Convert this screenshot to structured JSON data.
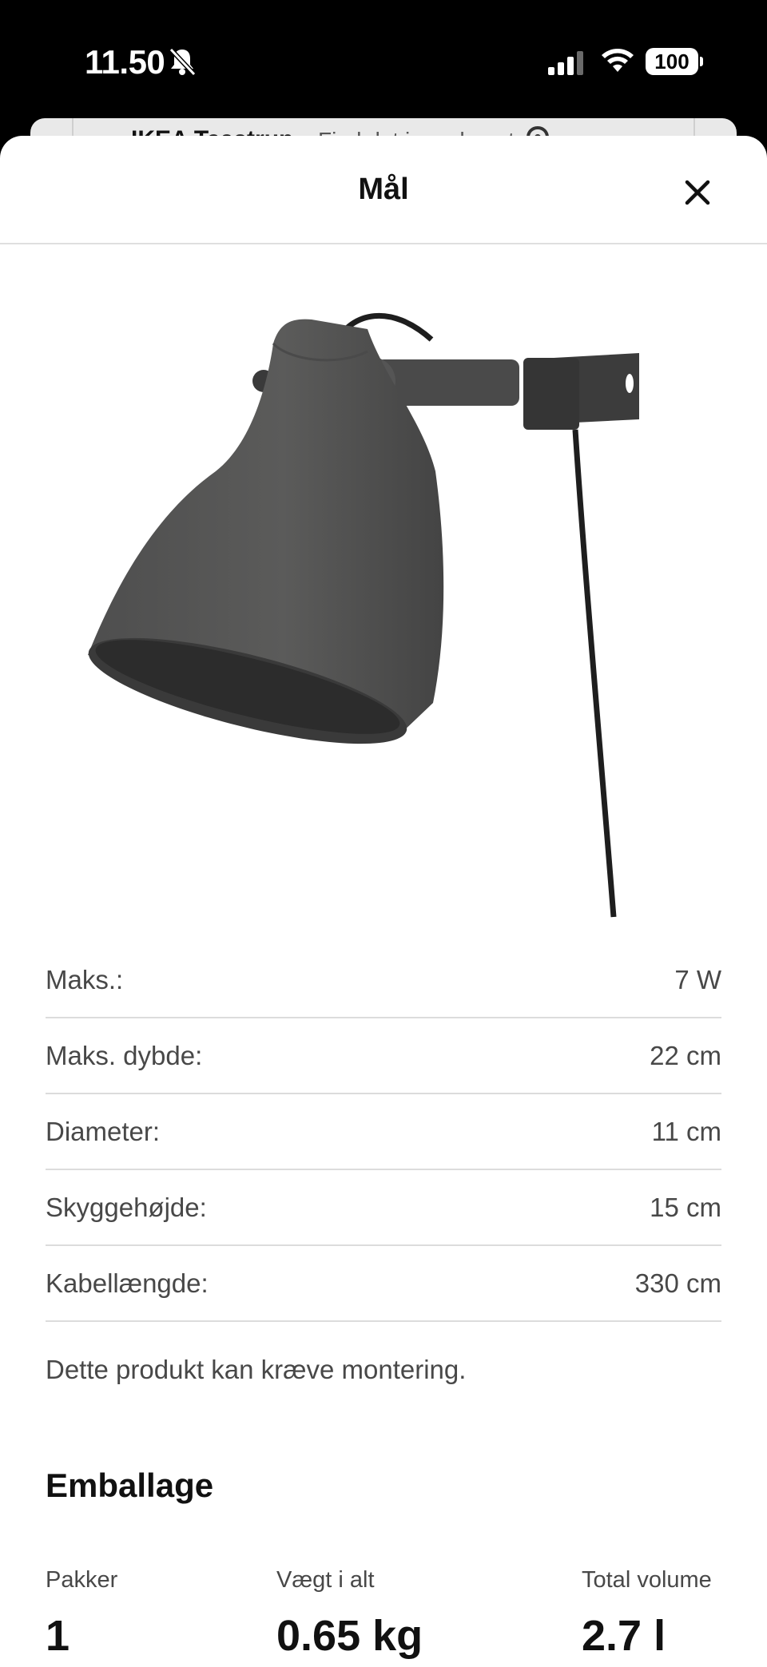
{
  "status_bar": {
    "time": "11.50",
    "battery": "100",
    "icons": [
      "bell-slash-icon",
      "signal-icon",
      "wifi-icon",
      "battery-icon"
    ]
  },
  "background_card": {
    "store": "IKEA Taastrup",
    "find_label": "Find det i varehuset"
  },
  "sheet": {
    "title": "Mål",
    "close_icon": "close-icon"
  },
  "specs": [
    {
      "label": "Maks.:",
      "value": "7 W"
    },
    {
      "label": "Maks. dybde:",
      "value": "22 cm"
    },
    {
      "label": "Diameter:",
      "value": "11 cm"
    },
    {
      "label": "Skyggehøjde:",
      "value": "15 cm"
    },
    {
      "label": "Kabellængde:",
      "value": "330 cm"
    }
  ],
  "note": "Dette produkt kan kræve montering.",
  "packaging": {
    "title": "Emballage",
    "columns": [
      {
        "label": "Pakker",
        "value": "1"
      },
      {
        "label": "Vægt i alt",
        "value": "0.65 kg"
      },
      {
        "label": "Total volume",
        "value": "2.7 l"
      }
    ]
  }
}
